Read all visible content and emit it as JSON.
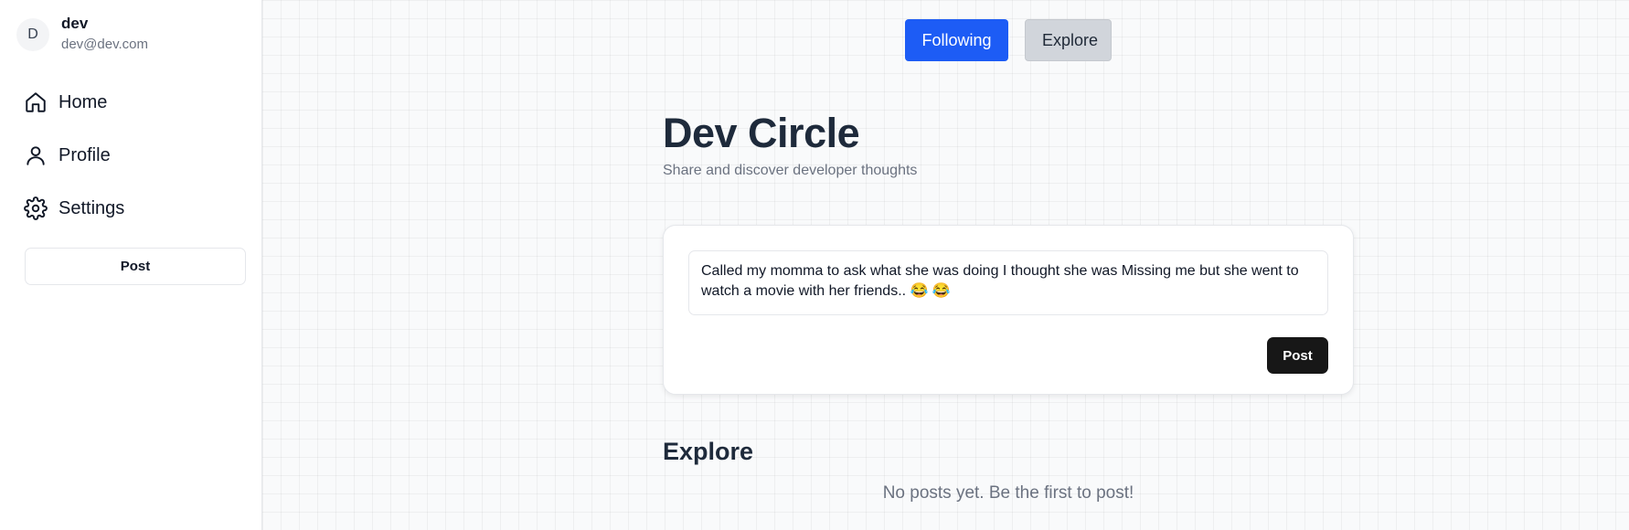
{
  "user": {
    "avatar_initial": "D",
    "name": "dev",
    "email": "dev@dev.com"
  },
  "sidebar": {
    "items": [
      {
        "label": "Home",
        "icon": "home-icon"
      },
      {
        "label": "Profile",
        "icon": "user-icon"
      },
      {
        "label": "Settings",
        "icon": "gear-icon"
      }
    ],
    "post_label": "Post"
  },
  "tabs": {
    "following_label": "Following",
    "explore_label": "Explore",
    "active": "Following"
  },
  "header": {
    "title": "Dev Circle",
    "subtitle": "Share and discover developer thoughts"
  },
  "composer": {
    "value": "Called my momma to ask what she was doing I thought she was Missing me but she went to watch a movie with her friends.. 😂 😂",
    "post_label": "Post"
  },
  "feed": {
    "title": "Explore",
    "empty_message": "No posts yet. Be the first to post!"
  },
  "colors": {
    "accent": "#1d5cf5",
    "dark_button": "#171717",
    "title": "#1e2a3b"
  }
}
